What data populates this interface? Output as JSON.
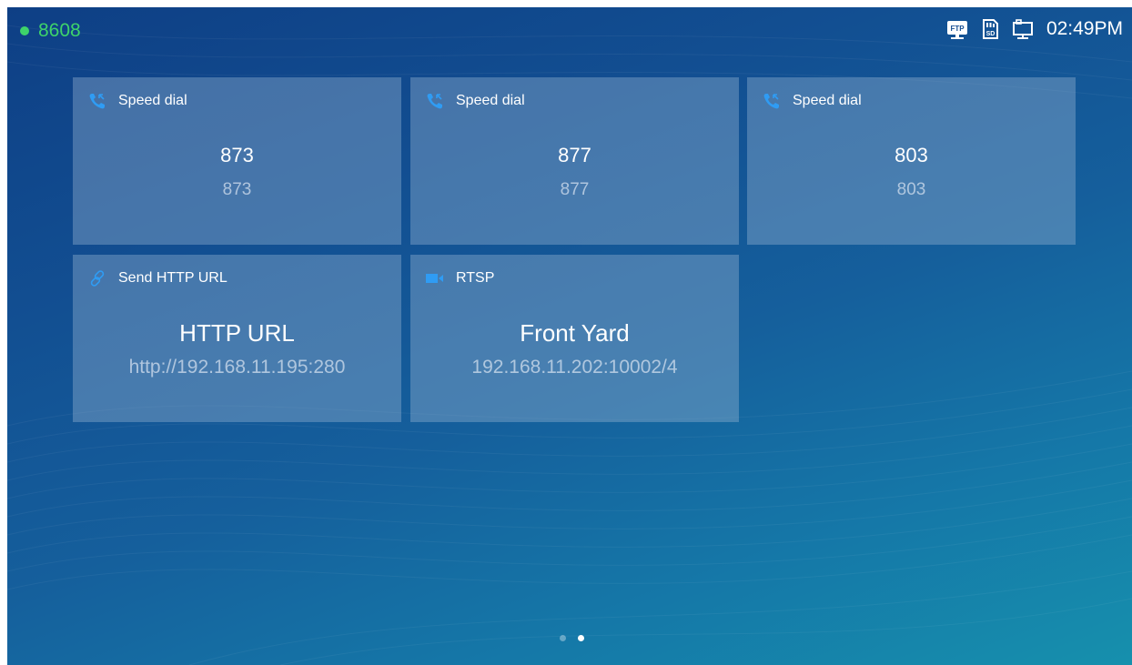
{
  "status_bar": {
    "account": "8608",
    "time": "02:49PM",
    "icons": [
      "ftp-icon",
      "sd-card-icon",
      "network-icon"
    ],
    "ftp_label": "FTP",
    "sd_label": "SD"
  },
  "colors": {
    "registered": "#3ed36a",
    "icon_blue": "#2f9cf4"
  },
  "tiles": [
    {
      "type": "Speed dial",
      "icon": "phone-icon",
      "name": "873",
      "value": "873"
    },
    {
      "type": "Speed dial",
      "icon": "phone-icon",
      "name": "877",
      "value": "877"
    },
    {
      "type": "Speed dial",
      "icon": "phone-icon",
      "name": "803",
      "value": "803"
    },
    {
      "type": "Send HTTP URL",
      "icon": "link-icon",
      "name": "HTTP URL",
      "value": "http://192.168.11.195:280"
    },
    {
      "type": "RTSP",
      "icon": "video-camera-icon",
      "name": "Front Yard",
      "value": "192.168.11.202:10002/4"
    }
  ],
  "pager": {
    "pages": 2,
    "active": 2
  }
}
